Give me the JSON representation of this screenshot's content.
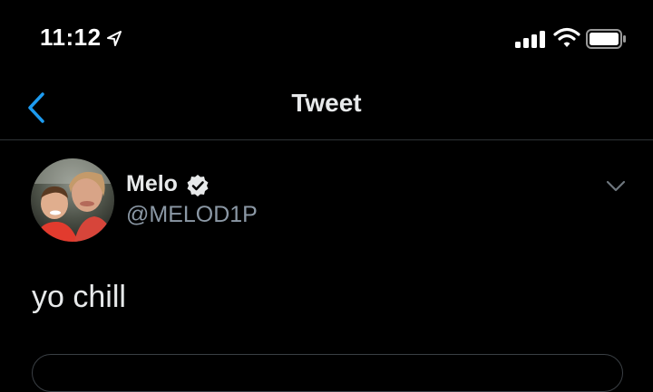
{
  "status_bar": {
    "time": "11:12",
    "location_icon": "location-arrow-icon",
    "signal_icon": "cellular-signal-icon",
    "wifi_icon": "wifi-icon",
    "battery_icon": "battery-icon"
  },
  "nav": {
    "back_icon": "chevron-left-icon",
    "title": "Tweet"
  },
  "tweet": {
    "author": {
      "display_name": "Melo",
      "handle": "@MELOD1P",
      "verified": true
    },
    "more_icon": "chevron-down-icon",
    "text": "yo chill"
  },
  "colors": {
    "background": "#000000",
    "accent": "#1d9bf0",
    "primary_text": "#e7e9ea",
    "secondary_text": "#8b98a5",
    "divider": "#2f3336"
  }
}
